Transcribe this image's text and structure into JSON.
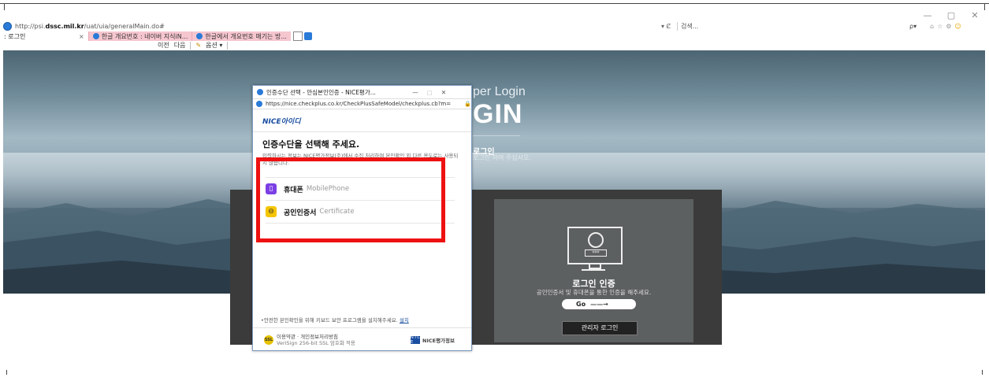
{
  "browser": {
    "url_prefix": "http://psi.",
    "url_host": "dssc.mil.kr",
    "url_path": "/uat/uia/generalMain.do#",
    "refresh_label": "▾ Ȼ",
    "search_placeholder": "검색...",
    "search_icon_label": "ρ▾",
    "window_controls": [
      "—",
      "▢",
      "✕"
    ],
    "tabs": [
      {
        "label": ": 로그인",
        "active": true
      },
      {
        "label": "한글 개요번호 : 네이버 지식iN...",
        "active": false
      },
      {
        "label": "한글에서 개요번호 매기는 방...",
        "active": false
      }
    ],
    "tab_close": "×",
    "find_bar": {
      "prev": "이전",
      "next": "다음",
      "options": "옵션 ▾"
    }
  },
  "hero": {
    "subtitle": "per Login",
    "title": "GIN",
    "heading": "로그인",
    "description": "로그인 하여 주십시오."
  },
  "login_card": {
    "monitor_pw": "***",
    "title": "로그인 인증",
    "description": "공인인증서 및 휴대폰을 통한 인증을 해주세요.",
    "go_label": "Go",
    "go_arrow": "——→",
    "admin_label": "관리자 로그인"
  },
  "popup": {
    "window_title": "인증수단 선택 - 안심본인인증 - NICE평가...",
    "controls": [
      "—",
      "▢",
      "✕"
    ],
    "url": "https://nice.checkplus.co.kr/CheckPlusSafeModel/checkplus.cb?m=",
    "lock": "🔒",
    "logo": "NICE아이디",
    "heading": "인증수단을 선택해 주세요.",
    "info": "입력하시는 정보는 NICE평가정보(주)에서 수집 처리하며 본인확인 외 다른 용도로는 사용되지 않습니다.",
    "options": [
      {
        "label": "휴대폰",
        "sub": "MobilePhone",
        "color": "#7b3fe4"
      },
      {
        "label": "공인인증서",
        "sub": "Certificate",
        "color": "#f5c400"
      }
    ],
    "notice_text": "•안전한 본인확인을 위해 키보드 보안 프로그램을 설치해주세요.",
    "notice_link": "설치",
    "footer_line1": "이용약관 · 개인정보처리방침",
    "footer_line2": "VeriSign 256-bit SSL 암호화 적용",
    "footer_badge": "SSL",
    "footer_brand": "NICE평가정보",
    "footer_brand_box": "N I\nC E"
  }
}
